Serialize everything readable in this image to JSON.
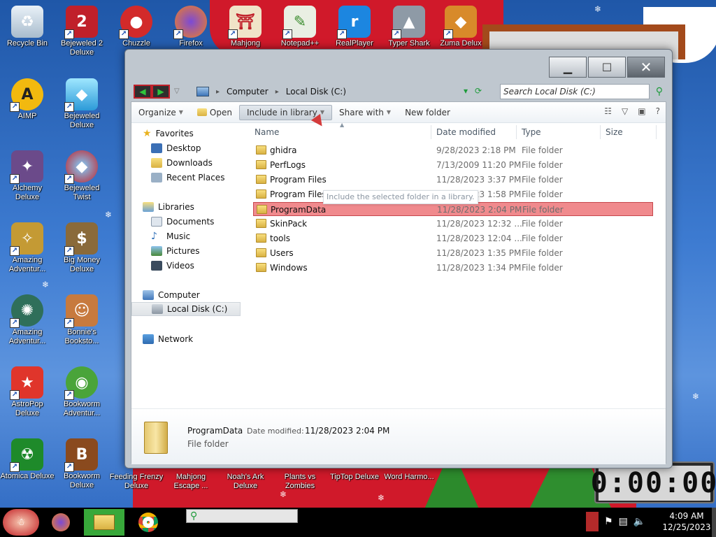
{
  "desktop_icons": [
    {
      "label": "Recycle Bin",
      "icon": "recycle-bin-icon"
    },
    {
      "label": "Bejeweled 2 Deluxe",
      "icon": "bejeweled2-icon"
    },
    {
      "label": "Chuzzle",
      "icon": "chuzzle-icon"
    },
    {
      "label": "Firefox",
      "icon": "firefox-icon"
    },
    {
      "label": "Mahjong",
      "icon": "mahjong-icon"
    },
    {
      "label": "Notepad++",
      "icon": "notepadpp-icon"
    },
    {
      "label": "RealPlayer",
      "icon": "realplayer-icon"
    },
    {
      "label": "Typer Shark",
      "icon": "typer-shark-icon"
    },
    {
      "label": "Zuma Delux",
      "icon": "zuma-icon"
    },
    {
      "label": "AIMP",
      "icon": "aimp-icon"
    },
    {
      "label": "Bejeweled Deluxe",
      "icon": "bejeweled-icon"
    },
    {
      "label": "Alchemy Deluxe",
      "icon": "alchemy-icon"
    },
    {
      "label": "Bejeweled Twist",
      "icon": "bejeweled-twist-icon"
    },
    {
      "label": "Amazing Adventur...",
      "icon": "amazing-adventures-icon"
    },
    {
      "label": "Big Money Deluxe",
      "icon": "big-money-icon"
    },
    {
      "label": "Amazing Adventur...",
      "icon": "amazing-adventures-2-icon"
    },
    {
      "label": "Bonnie's Booksto...",
      "icon": "bonnies-bookstore-icon"
    },
    {
      "label": "AstroPop Deluxe",
      "icon": "astropop-icon"
    },
    {
      "label": "Bookworm Adventur...",
      "icon": "bookworm-adventures-icon"
    },
    {
      "label": "Atomica Deluxe",
      "icon": "atomica-icon"
    },
    {
      "label": "Bookworm Deluxe",
      "icon": "bookworm-icon"
    },
    {
      "label": "Feeding Frenzy Deluxe",
      "icon": "feeding-frenzy-icon"
    },
    {
      "label": "Mahjong Escape ...",
      "icon": "mahjong-escape-icon"
    },
    {
      "label": "Noah's Ark Deluxe",
      "icon": "noahs-ark-icon"
    },
    {
      "label": "Plants vs Zombies",
      "icon": "plants-vs-zombies-icon"
    },
    {
      "label": "TipTop Deluxe",
      "icon": "tiptop-icon"
    },
    {
      "label": "Word Harmo...",
      "icon": "word-harmony-icon"
    }
  ],
  "explorer": {
    "breadcrumb": [
      "Computer",
      "Local Disk (C:)"
    ],
    "search_placeholder": "Search Local Disk (C:)",
    "toolbar": {
      "organize": "Organize",
      "open": "Open",
      "include_in_library": "Include in library",
      "share_with": "Share with",
      "new_folder": "New folder"
    },
    "tooltip": "Include the selected folder in a library.",
    "nav": {
      "favorites": "Favorites",
      "desktop": "Desktop",
      "downloads": "Downloads",
      "recent_places": "Recent Places",
      "libraries": "Libraries",
      "documents": "Documents",
      "music": "Music",
      "pictures": "Pictures",
      "videos": "Videos",
      "computer": "Computer",
      "local_disk": "Local Disk (C:)",
      "network": "Network"
    },
    "columns": {
      "name": "Name",
      "date": "Date modified",
      "type": "Type",
      "size": "Size"
    },
    "files": [
      {
        "name": "ghidra",
        "date": "9/28/2023 2:18 PM",
        "type": "File folder"
      },
      {
        "name": "PerfLogs",
        "date": "7/13/2009 11:20 PM",
        "type": "File folder"
      },
      {
        "name": "Program Files",
        "date": "11/28/2023 3:37 PM",
        "type": "File folder"
      },
      {
        "name": "Program Files (x86)",
        "date": "11/28/2023 1:58 PM",
        "type": "File folder"
      },
      {
        "name": "ProgramData",
        "date": "11/28/2023 2:04 PM",
        "type": "File folder"
      },
      {
        "name": "SkinPack",
        "date": "11/28/2023 12:32 ...",
        "type": "File folder"
      },
      {
        "name": "tools",
        "date": "11/28/2023 12:04 ...",
        "type": "File folder"
      },
      {
        "name": "Users",
        "date": "11/28/2023 1:35 PM",
        "type": "File folder"
      },
      {
        "name": "Windows",
        "date": "11/28/2023 1:34 PM",
        "type": "File folder"
      }
    ],
    "selected_index": 4,
    "details": {
      "name": "ProgramData",
      "date_label": "Date modified:",
      "date_value": "11/28/2023 2:04 PM",
      "type": "File folder"
    }
  },
  "widget_clock": "0:00:00",
  "taskbar": {
    "time": "4:09 AM",
    "date": "12/25/2023"
  },
  "colors": {
    "selection": "#f08a8d",
    "taskbar": "#000000",
    "wallpaper_red": "#d0192a"
  }
}
